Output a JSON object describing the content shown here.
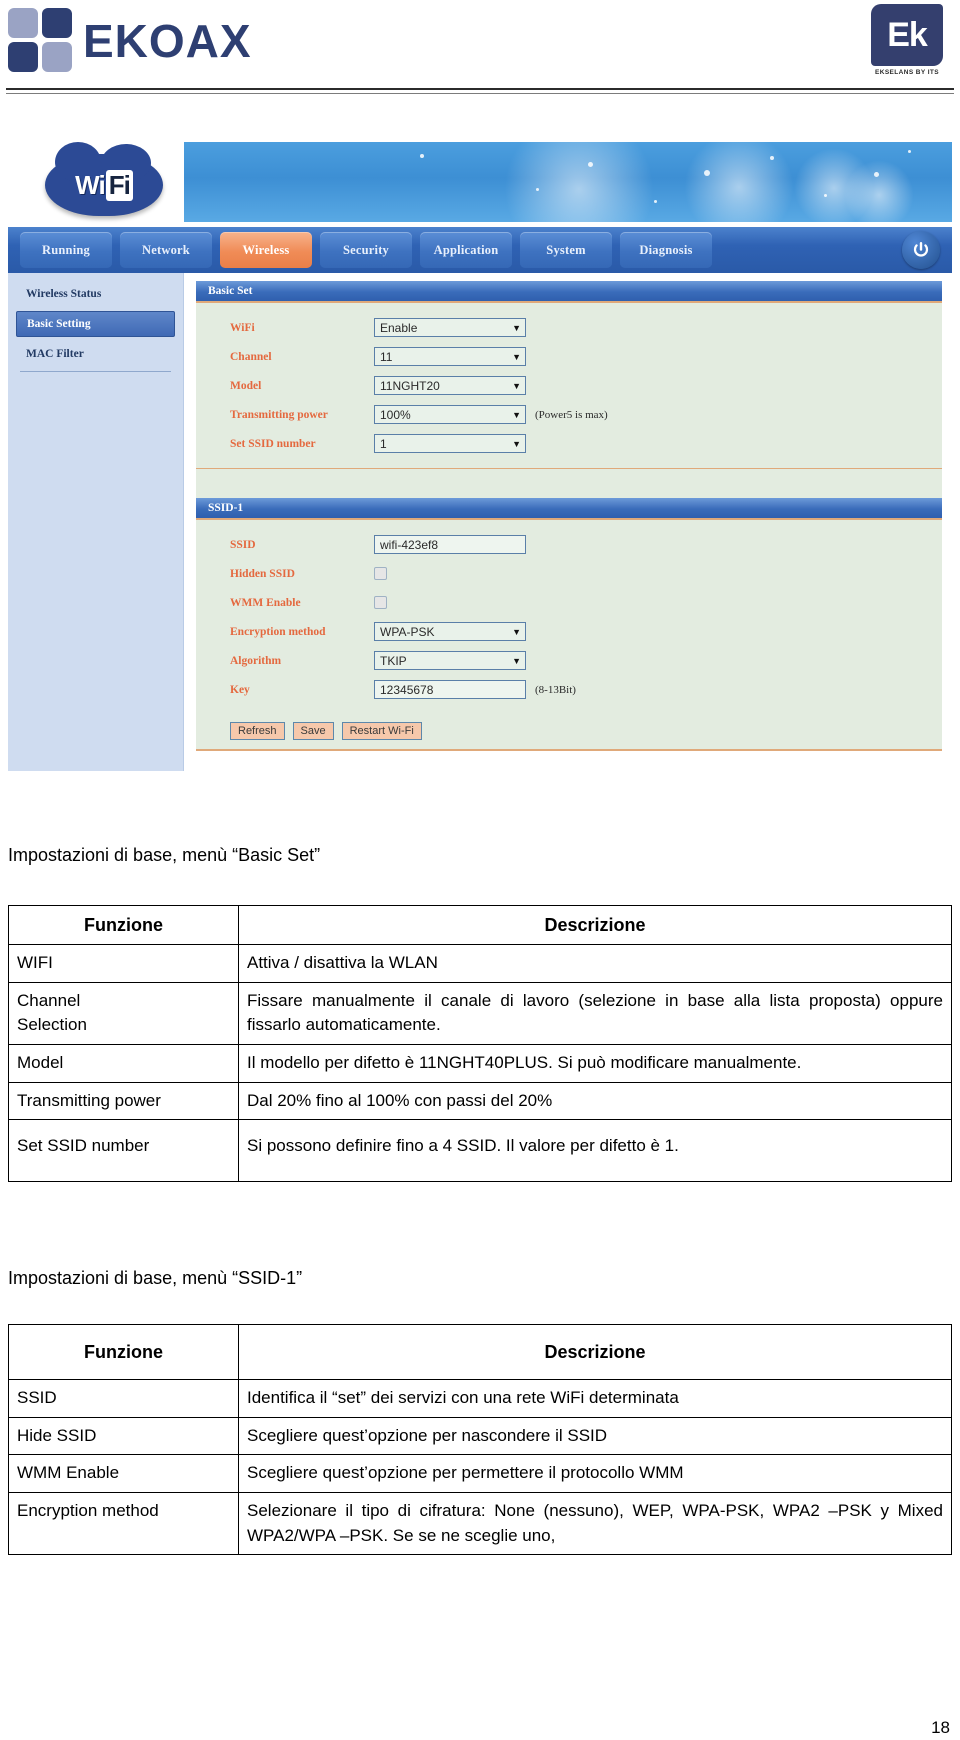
{
  "header": {
    "brand_name": "EKOAX",
    "corner_logo_text": "Ek",
    "corner_logo_sub": "EKSELANS BY ITS"
  },
  "router_ui": {
    "logo_text_wi": "Wi",
    "logo_text_fi": "Fi",
    "nav": [
      {
        "label": "Running",
        "active": false
      },
      {
        "label": "Network",
        "active": false
      },
      {
        "label": "Wireless",
        "active": true
      },
      {
        "label": "Security",
        "active": false
      },
      {
        "label": "Application",
        "active": false
      },
      {
        "label": "System",
        "active": false
      },
      {
        "label": "Diagnosis",
        "active": false
      }
    ],
    "power_icon": "power-icon",
    "sidebar": [
      {
        "label": "Wireless Status",
        "selected": false
      },
      {
        "label": "Basic Setting",
        "selected": true
      },
      {
        "label": "MAC Filter",
        "selected": false
      }
    ],
    "basic_set": {
      "title": "Basic Set",
      "fields": [
        {
          "label": "WiFi",
          "type": "select",
          "value": "Enable",
          "note": ""
        },
        {
          "label": "Channel",
          "type": "select",
          "value": "11",
          "note": ""
        },
        {
          "label": "Model",
          "type": "select",
          "value": "11NGHT20",
          "note": ""
        },
        {
          "label": "Transmitting power",
          "type": "select",
          "value": "100%",
          "note": "(Power5 is max)"
        },
        {
          "label": "Set SSID number",
          "type": "select",
          "value": "1",
          "note": ""
        }
      ]
    },
    "ssid1": {
      "title": "SSID-1",
      "fields": [
        {
          "label": "SSID",
          "type": "text",
          "value": "wifi-423ef8",
          "note": ""
        },
        {
          "label": "Hidden SSID",
          "type": "checkbox",
          "value": "",
          "note": "",
          "checked": false
        },
        {
          "label": "WMM Enable",
          "type": "checkbox",
          "value": "",
          "note": "",
          "checked": false
        },
        {
          "label": "Encryption method",
          "type": "select",
          "value": "WPA-PSK",
          "note": ""
        },
        {
          "label": "Algorithm",
          "type": "select",
          "value": "TKIP",
          "note": ""
        },
        {
          "label": "Key",
          "type": "text",
          "value": "12345678",
          "note": "(8-13Bit)"
        }
      ]
    },
    "buttons": [
      {
        "label": "Refresh"
      },
      {
        "label": "Save"
      },
      {
        "label": "Restart Wi-Fi"
      }
    ]
  },
  "doc": {
    "caption1": "Impostazioni di base, menù “Basic Set”",
    "caption2": "Impostazioni di base, menù “SSID-1”",
    "table1": {
      "headers": [
        "Funzione",
        "Descrizione"
      ],
      "rows": [
        {
          "fn": "WIFI",
          "desc": "Attiva / disattiva la WLAN"
        },
        {
          "fn": "Channel\nSelection",
          "desc": "Fissare manualmente il canale di lavoro (selezione in base alla lista proposta) oppure fissarlo automaticamente."
        },
        {
          "fn": "Model",
          "desc": "Il modello per difetto è 11NGHT40PLUS. Si può modificare manualmente."
        },
        {
          "fn": "Transmitting power",
          "desc": "Dal 20% fino al 100% con passi del 20%"
        },
        {
          "fn": "Set SSID number",
          "desc": "Si possono definire fino a 4 SSID. Il valore per difetto è 1."
        }
      ]
    },
    "table2": {
      "headers": [
        "Funzione",
        "Descrizione"
      ],
      "rows": [
        {
          "fn": "SSID",
          "desc": "Identifica il “set” dei servizi con una rete WiFi determinata"
        },
        {
          "fn": "Hide  SSID",
          "desc": "Scegliere quest’opzione per nascondere il SSID"
        },
        {
          "fn": "WMM  Enable",
          "desc": "Scegliere quest’opzione per permettere il protocollo WMM"
        },
        {
          "fn": "Encryption  method",
          "desc": "Selezionare il tipo di cifratura: None (nessuno), WEP, WPA-PSK, WPA2 –PSK y Mixed WPA2/WPA –PSK. Se se ne sceglie uno,"
        }
      ]
    },
    "page_number": "18"
  }
}
